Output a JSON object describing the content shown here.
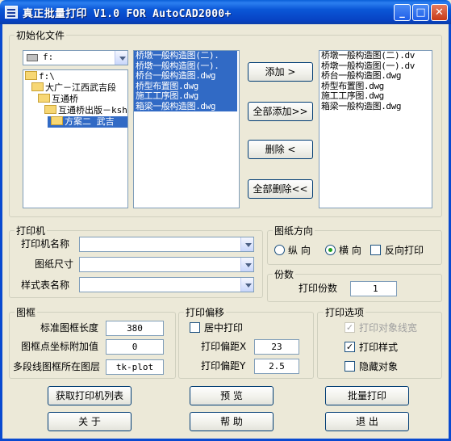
{
  "window": {
    "title": "真正批量打印 V1.0 FOR AutoCAD2000+"
  },
  "init_group": {
    "title": "初始化文件",
    "drive": "f:",
    "folders": [
      "f:\\",
      "大广－江西武吉段",
      "互通桥",
      "互通桥出版－ksh",
      "方案二 武吉"
    ],
    "source_files": [
      "桥墩一般构造图(二).",
      "桥墩一般构造图(一).",
      "桥台一般构造图.dwg",
      "桥型布置图.dwg",
      "施工工序图.dwg",
      "箱梁一般构造图.dwg"
    ],
    "selected_files": [
      "桥墩一般构造图(二).dv",
      "桥墩一般构造图(一).dv",
      "桥台一般构造图.dwg",
      "桥型布置图.dwg",
      "施工工序图.dwg",
      "箱梁一般构造图.dwg"
    ],
    "buttons": {
      "add": "添加 >",
      "add_all": "全部添加>>",
      "remove": "删除 <",
      "remove_all": "全部删除<<"
    }
  },
  "printer_group": {
    "title": "打印机",
    "printer_name_label": "打印机名称",
    "paper_size_label": "图纸尺寸",
    "style_table_label": "样式表名称",
    "printer_name": "",
    "paper_size": "",
    "style_table": ""
  },
  "orientation_group": {
    "title": "图纸方向",
    "portrait": "纵 向",
    "landscape": "横 向",
    "reverse": "反向打印",
    "selected": "landscape"
  },
  "copies_group": {
    "title": "份数",
    "label": "打印份数",
    "value": "1"
  },
  "frame_group": {
    "title": "图框",
    "std_length_label": "标准图框长度",
    "std_length": "380",
    "point_coord_label": "图框点坐标附加值",
    "point_coord": "0",
    "polyline_layer_label": "多段线图框所在图层",
    "polyline_layer": "tk-plot"
  },
  "offset_group": {
    "title": "打印偏移",
    "center_label": "居中打印",
    "offset_x_label": "打印偏距X",
    "offset_x": "23",
    "offset_y_label": "打印偏距Y",
    "offset_y": "2.5"
  },
  "options_group": {
    "title": "打印选项",
    "line_width_label": "打印对象线宽",
    "plot_styles_label": "打印样式",
    "hide_objects_label": "隐藏对象"
  },
  "buttons": {
    "get_printers": "获取打印机列表",
    "preview": "预 览",
    "batch_print": "批量打印",
    "about": "关 于",
    "help": "帮 助",
    "exit": "退 出"
  }
}
